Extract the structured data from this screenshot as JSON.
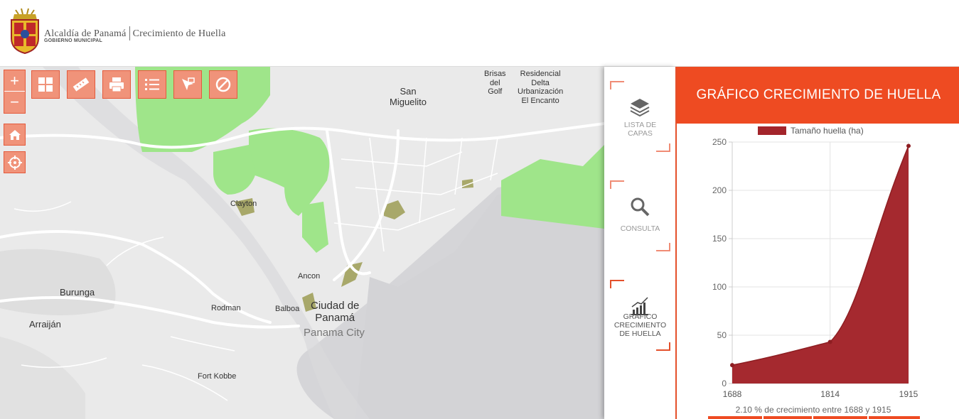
{
  "header": {
    "org_name": "Alcaldía de Panamá",
    "org_sub": "GOBIERNO MUNICIPAL",
    "app_title": "Crecimiento de Huella"
  },
  "toolbar": {
    "zoom_in": "+",
    "zoom_out": "−",
    "buttons": [
      "grid-icon",
      "ruler-icon",
      "printer-icon",
      "list-icon",
      "select-icon",
      "clear-icon"
    ]
  },
  "map": {
    "labels": {
      "san_miguelito": "San\nMiguelito",
      "brisas": "Brisas\ndel\nGolf",
      "residencial": "Residencial\nDelta\nUrbanización\nEl Encanto",
      "clayton": "Clayton",
      "ancon": "Ancon",
      "burunga": "Burunga",
      "rodman": "Rodman",
      "balboa": "Balboa",
      "ciudad": "Ciudad de\nPanamá",
      "panama_city": "Panama City",
      "arraijan": "Arraiján",
      "fort_kobbe": "Fort Kobbe"
    },
    "colors": {
      "green": "#9fe58a",
      "olive": "#a8a86a",
      "land": "#eaeaea",
      "water": "#d5d5d8"
    }
  },
  "sidebar": {
    "items": [
      {
        "label": "LISTA DE\nCAPAS",
        "icon": "layers-icon"
      },
      {
        "label": "CONSULTA",
        "icon": "search-icon"
      },
      {
        "label": "GRÁFICO\nCRECIMIENTO\nDE HUELLA",
        "icon": "growth-chart-icon"
      }
    ]
  },
  "panel": {
    "title": "GRÁFICO CRECIMIENTO DE HUELLA",
    "caption": "2.10 % de crecimiento entre 1688 y 1915",
    "accent": "#ee4b22"
  },
  "chart_data": {
    "type": "area",
    "legend": "Tamaño huella (ha)",
    "x": [
      1688,
      1814,
      1915
    ],
    "categories": [
      "1688",
      "1814",
      "1915"
    ],
    "values": [
      19,
      43,
      246
    ],
    "ylim": [
      0,
      250
    ],
    "yticks": [
      0,
      50,
      100,
      150,
      200,
      250
    ],
    "color": "#a3252b",
    "grid": true,
    "legend_position": "top"
  }
}
